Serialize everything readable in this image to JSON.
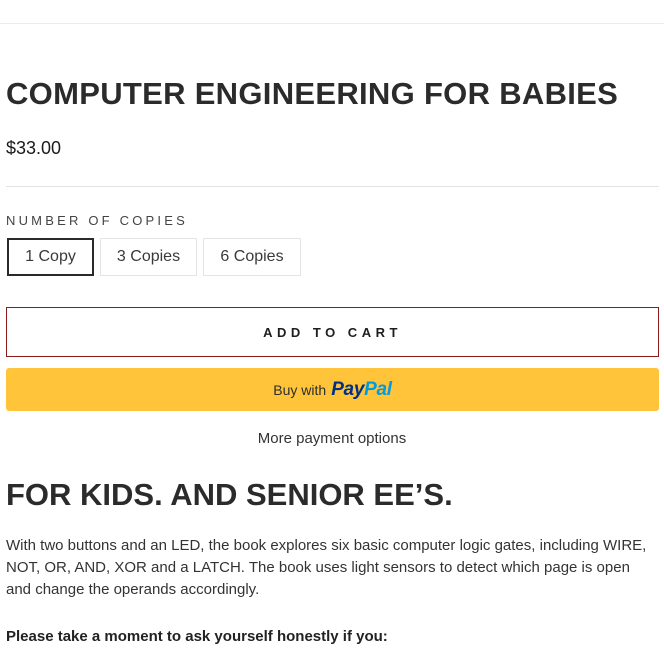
{
  "product": {
    "title": "COMPUTER ENGINEERING FOR BABIES",
    "price": "$33.00"
  },
  "variants": {
    "label": "NUMBER OF COPIES",
    "options": [
      "1 Copy",
      "3 Copies",
      "6 Copies"
    ],
    "selected": "1 Copy"
  },
  "actions": {
    "add_to_cart": "ADD TO CART",
    "paypal_prefix": "Buy with",
    "paypal_brand_pay": "Pay",
    "paypal_brand_pal": "Pal",
    "more_payment_options": "More payment options"
  },
  "content": {
    "heading": "FOR KIDS. AND SENIOR EE’S.",
    "description": "With two buttons and an LED, the book explores six basic computer logic gates, including WIRE, NOT, OR, AND, XOR and a LATCH. The book uses light sensors to detect which page is open and change the operands accordingly.",
    "prompt": "Please take a moment to ask yourself honestly if you:"
  },
  "colors": {
    "paypal_button": "#ffc439",
    "paypal_dark_blue": "#003087",
    "paypal_light_blue": "#009cde",
    "add_to_cart_border": "#8b1a1a"
  }
}
